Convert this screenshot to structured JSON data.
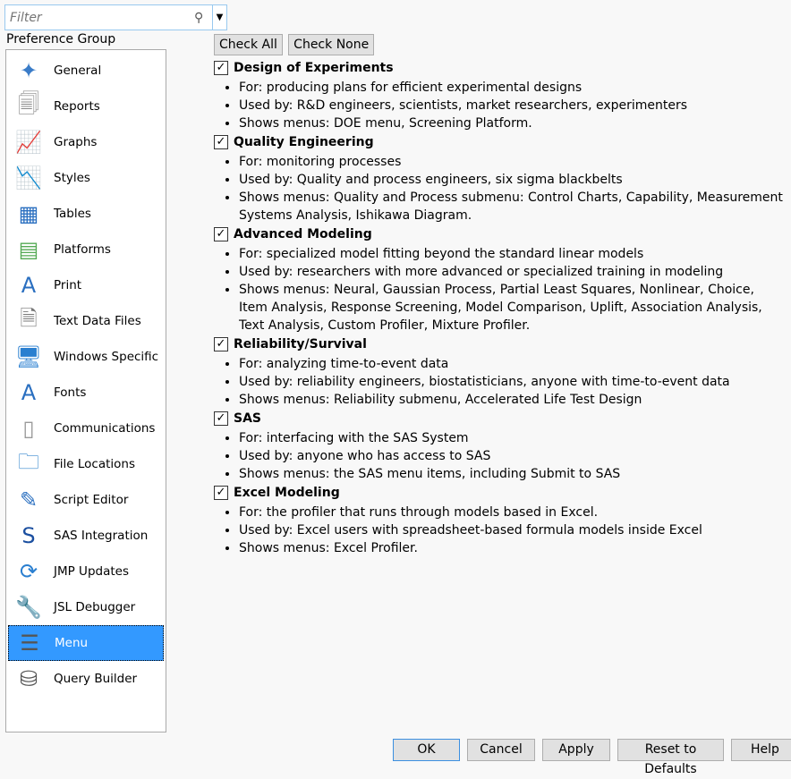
{
  "filter": {
    "placeholder": "Filter"
  },
  "sidebar": {
    "label": "Preference Group",
    "items": [
      {
        "label": "General",
        "icon": "✦",
        "color": "#3a7cc8"
      },
      {
        "label": "Reports",
        "icon": "🗐",
        "color": "#888"
      },
      {
        "label": "Graphs",
        "icon": "📈",
        "color": "#555"
      },
      {
        "label": "Styles",
        "icon": "📉",
        "color": "#555"
      },
      {
        "label": "Tables",
        "icon": "▦",
        "color": "#2a6fc0"
      },
      {
        "label": "Platforms",
        "icon": "▤",
        "color": "#5a5"
      },
      {
        "label": "Print",
        "icon": "A",
        "color": "#2a6fc0"
      },
      {
        "label": "Text Data Files",
        "icon": "🗎",
        "color": "#777"
      },
      {
        "label": "Windows Specific",
        "icon": "🖥",
        "color": "#2a7fd0"
      },
      {
        "label": "Fonts",
        "icon": "A",
        "color": "#2a6fc0"
      },
      {
        "label": "Communications",
        "icon": "▯",
        "color": "#999"
      },
      {
        "label": "File Locations",
        "icon": "🗀",
        "color": "#3a8ad0"
      },
      {
        "label": "Script Editor",
        "icon": "✎",
        "color": "#2a6fc0"
      },
      {
        "label": "SAS Integration",
        "icon": "S",
        "color": "#1b4fa0"
      },
      {
        "label": "JMP Updates",
        "icon": "⟳",
        "color": "#2a7fd0"
      },
      {
        "label": "JSL Debugger",
        "icon": "🔧",
        "color": "#777"
      },
      {
        "label": "Menu",
        "icon": "☰",
        "color": "#555"
      },
      {
        "label": "Query Builder",
        "icon": "⛁",
        "color": "#555"
      }
    ],
    "selected": "Menu"
  },
  "main": {
    "check_all": "Check All",
    "check_none": "Check None",
    "sections": [
      {
        "title": "Design of Experiments",
        "checked": true,
        "bullets": [
          "For: producing plans for efficient experimental designs",
          "Used by: R&D engineers, scientists, market researchers, experimenters",
          "Shows menus: DOE menu, Screening Platform."
        ]
      },
      {
        "title": "Quality Engineering",
        "checked": true,
        "bullets": [
          "For: monitoring processes",
          "Used by: Quality and process engineers, six sigma blackbelts",
          "Shows menus: Quality and Process submenu: Control Charts, Capability, Measurement Systems Analysis, Ishikawa Diagram."
        ]
      },
      {
        "title": "Advanced Modeling",
        "checked": true,
        "bullets": [
          "For: specialized model fitting beyond the standard linear models",
          "Used by: researchers with more advanced or specialized training in modeling",
          "Shows menus: Neural, Gaussian Process, Partial Least Squares, Nonlinear, Choice, Item Analysis, Response Screening, Model Comparison, Uplift, Association Analysis, Text Analysis, Custom Profiler, Mixture Profiler."
        ]
      },
      {
        "title": "Reliability/Survival",
        "checked": true,
        "bullets": [
          "For: analyzing time-to-event data",
          "Used by: reliability engineers, biostatisticians, anyone with time-to-event data",
          "Shows menus: Reliability submenu, Accelerated Life Test Design"
        ]
      },
      {
        "title": "SAS",
        "checked": true,
        "bullets": [
          "For: interfacing with the SAS System",
          "Used by: anyone who has access to SAS",
          "Shows menus: the SAS menu items, including Submit to SAS"
        ]
      },
      {
        "title": "Excel Modeling",
        "checked": true,
        "bullets": [
          "For: the profiler that runs through models based in Excel.",
          "Used by: Excel users with spreadsheet-based formula models inside Excel",
          "Shows menus: Excel Profiler."
        ]
      }
    ]
  },
  "footer": {
    "ok": "OK",
    "cancel": "Cancel",
    "apply": "Apply",
    "reset": "Reset to Defaults",
    "help": "Help"
  }
}
